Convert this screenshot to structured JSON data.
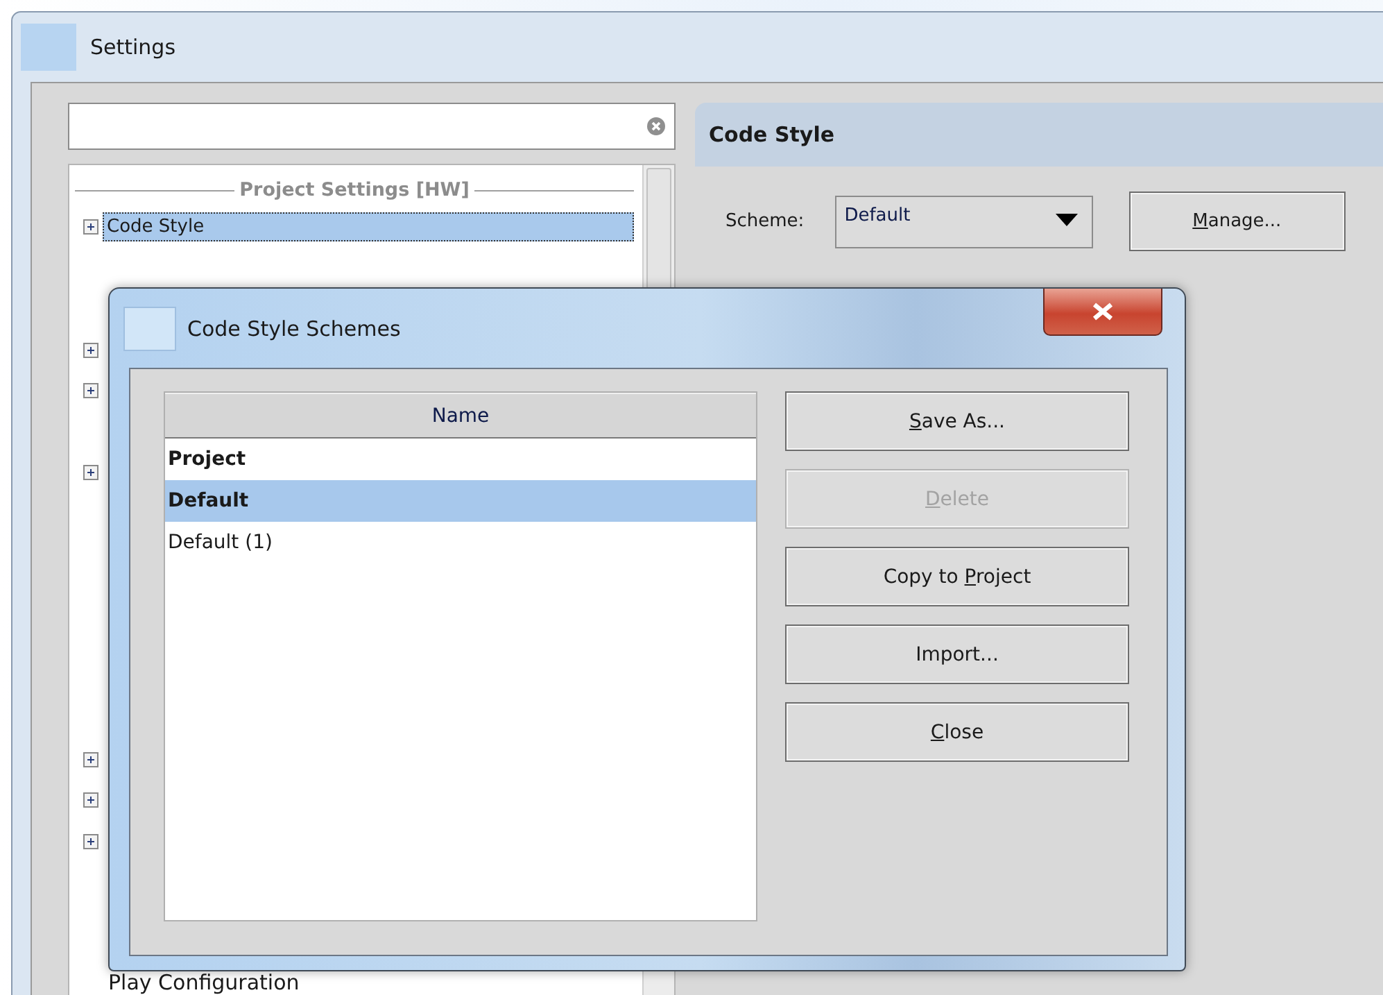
{
  "window": {
    "title": "Settings"
  },
  "tree": {
    "header": "Project Settings [HW]",
    "rows": [
      {
        "kind": "node",
        "label": "Code Style",
        "selected": true,
        "expanded": false
      },
      {
        "kind": "leaf"
      },
      {
        "kind": "leaf"
      },
      {
        "kind": "node",
        "expanded": false
      },
      {
        "kind": "node",
        "expanded": false
      },
      {
        "kind": "leaf"
      },
      {
        "kind": "node",
        "expanded": false
      },
      {
        "kind": "leaf"
      },
      {
        "kind": "leaf"
      },
      {
        "kind": "leaf"
      },
      {
        "kind": "leaf"
      },
      {
        "kind": "leaf"
      },
      {
        "kind": "leaf"
      },
      {
        "kind": "node",
        "expanded": false
      },
      {
        "kind": "node",
        "expanded": false
      },
      {
        "kind": "node",
        "expanded": false
      },
      {
        "kind": "leaf"
      },
      {
        "kind": "overflow",
        "label": "Play Configuration"
      }
    ]
  },
  "panel": {
    "title": "Code Style",
    "scheme_label": "Scheme:",
    "scheme_value": "Default",
    "manage_button": {
      "key": "M",
      "post": "anage..."
    }
  },
  "dialog": {
    "title": "Code Style Schemes",
    "table": {
      "columns": [
        "Name"
      ],
      "rows": [
        {
          "name": "Project",
          "bold": true,
          "selected": false
        },
        {
          "name": "Default",
          "bold": true,
          "selected": true
        },
        {
          "name": "Default (1)",
          "bold": false,
          "selected": false
        }
      ]
    },
    "buttons": [
      {
        "key": "S",
        "post": "ave As...",
        "disabled": false
      },
      {
        "key": "D",
        "post": "elete",
        "disabled": true
      },
      {
        "pre": "Copy to ",
        "key": "P",
        "post": "roject",
        "disabled": false
      },
      {
        "pre": "Import...",
        "disabled": false
      },
      {
        "key": "C",
        "post": "lose",
        "disabled": false
      }
    ]
  }
}
